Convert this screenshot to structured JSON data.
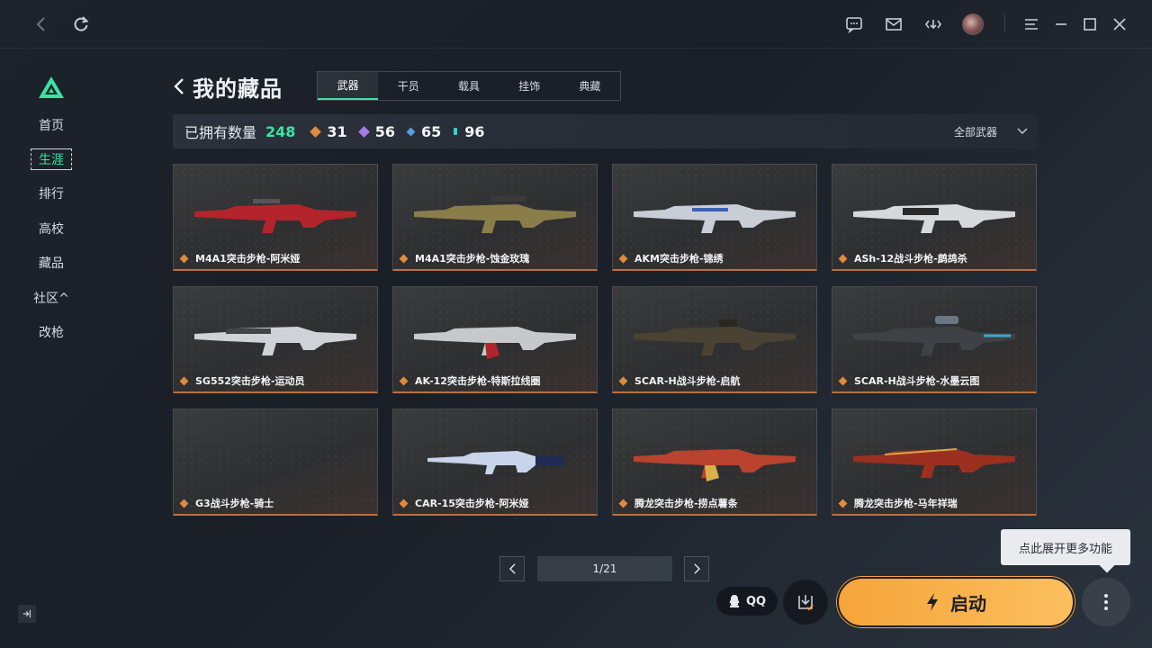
{
  "colors": {
    "accent": "#3be3a2",
    "launch": "#f6a43a",
    "rarity_orange": "#e08a3c",
    "rarity_purple": "#a77be8",
    "rarity_blue": "#5b9ae0",
    "rarity_cyan": "#35d3c8"
  },
  "topbar": {
    "icons": [
      "back-arrow-icon",
      "refresh-icon",
      "chat-icon",
      "mail-icon",
      "signal-icon",
      "menu-icon",
      "minimize-icon",
      "maximize-icon",
      "close-icon"
    ]
  },
  "sidebar": {
    "items": [
      {
        "label": "首页"
      },
      {
        "label": "生涯"
      },
      {
        "label": "排行"
      },
      {
        "label": "高校"
      },
      {
        "label": "藏品"
      },
      {
        "label": "社区^"
      },
      {
        "label": "改枪"
      }
    ]
  },
  "page": {
    "title": "我的藏品"
  },
  "tabs": [
    {
      "label": "武器"
    },
    {
      "label": "干员"
    },
    {
      "label": "载具"
    },
    {
      "label": "挂饰"
    },
    {
      "label": "典藏"
    }
  ],
  "stats": {
    "owned_label": "已拥有数量",
    "owned_count": "248",
    "orange": "31",
    "purple": "56",
    "blue": "65",
    "cyan": "96",
    "filter_label": "全部武器"
  },
  "items": [
    {
      "name": "M4A1突击步枪-阿米娅",
      "gun_color": "#b3242b"
    },
    {
      "name": "M4A1突击步枪-蚀金玫瑰",
      "gun_color": "#8b7d4a"
    },
    {
      "name": "AKM突击步枪-锦绣",
      "gun_color": "#c9ced6"
    },
    {
      "name": "ASh-12战斗步枪-鹧鸪杀",
      "gun_color": "#d6d8da"
    },
    {
      "name": "SG552突击步枪-运动员",
      "gun_color": "#cfd2d6"
    },
    {
      "name": "AK-12突击步枪-特斯拉线圈",
      "gun_color": "#c6c9cc"
    },
    {
      "name": "SCAR-H战斗步枪-启航",
      "gun_color": "#4a4232"
    },
    {
      "name": "SCAR-H战斗步枪-水墨云图",
      "gun_color": "#3e4145"
    },
    {
      "name": "G3战斗步枪-骑士",
      "gun_color": ""
    },
    {
      "name": "CAR-15突击步枪-阿米娅",
      "gun_color": "#c8d4ea"
    },
    {
      "name": "腾龙突击步枪-捞点薯条",
      "gun_color": "#b9432e"
    },
    {
      "name": "腾龙突击步枪-马年祥瑞",
      "gun_color": "#9b3020"
    }
  ],
  "pagination": {
    "label": "1/21"
  },
  "tooltip": {
    "text": "点此展开更多功能"
  },
  "actions": {
    "qq_label": "QQ",
    "launch_label": "启动"
  }
}
